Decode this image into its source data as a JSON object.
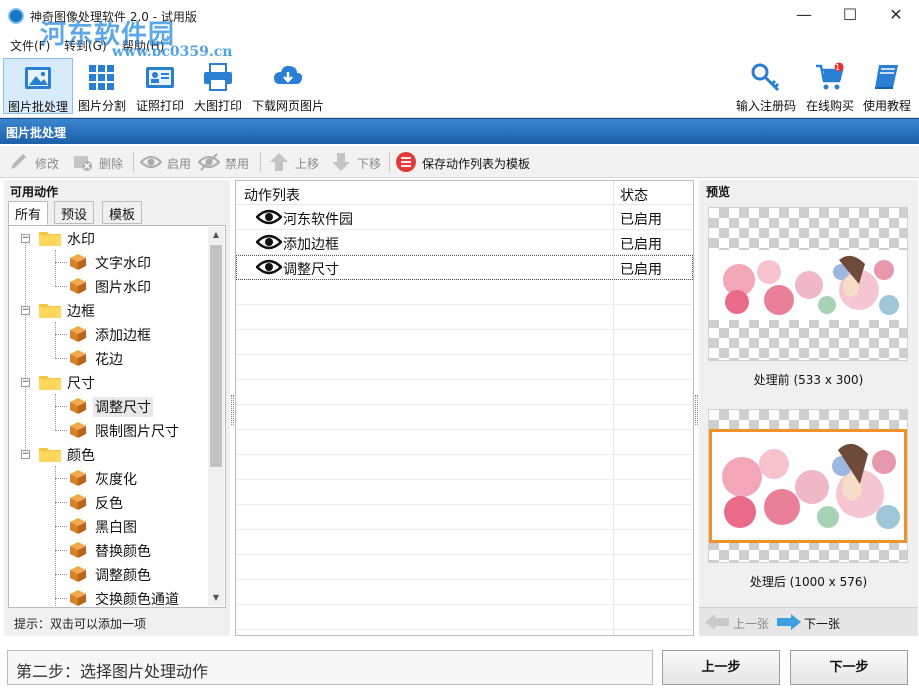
{
  "window": {
    "title": "神奇图像处理软件 2.0 - 试用版",
    "watermark_logo": "河东软件园",
    "watermark_url": "www.pc0359.cn",
    "controls": [
      "—",
      "☐",
      "✕"
    ]
  },
  "menu": [
    "文件(F)",
    "转到(G)",
    "帮助(H)"
  ],
  "toolbar": {
    "left": [
      {
        "label": "图片批处理",
        "icon": "image-icon",
        "active": true
      },
      {
        "label": "图片分割",
        "icon": "grid-icon"
      },
      {
        "label": "证照打印",
        "icon": "id-card-icon"
      },
      {
        "label": "大图打印",
        "icon": "printer-icon"
      },
      {
        "label": "下载网页图片",
        "icon": "cloud-download-icon"
      }
    ],
    "right": [
      {
        "label": "输入注册码",
        "icon": "key-icon"
      },
      {
        "label": "在线购买",
        "icon": "cart-icon",
        "badge": "1"
      },
      {
        "label": "使用教程",
        "icon": "book-icon"
      }
    ]
  },
  "section_title": "图片批处理",
  "action_toolbar": {
    "edit": "修改",
    "delete": "删除",
    "enable": "启用",
    "disable": "禁用",
    "move_up": "上移",
    "move_down": "下移",
    "save_template": "保存动作列表为模板"
  },
  "available_actions": {
    "title": "可用动作",
    "tabs": [
      "所有",
      "预设",
      "模板"
    ],
    "tree": [
      {
        "label": "水印",
        "children": [
          "文字水印",
          "图片水印"
        ]
      },
      {
        "label": "边框",
        "children": [
          "添加边框",
          "花边"
        ]
      },
      {
        "label": "尺寸",
        "children": [
          "调整尺寸",
          "限制图片尺寸"
        ]
      },
      {
        "label": "颜色",
        "children": [
          "灰度化",
          "反色",
          "黑白图",
          "替换颜色",
          "调整颜色",
          "交换颜色通道"
        ]
      }
    ],
    "hint": "提示：双击可以添加一项"
  },
  "action_list": {
    "headers": {
      "name": "动作列表",
      "status": "状态"
    },
    "rows": [
      {
        "name": "河东软件园",
        "status": "已启用"
      },
      {
        "name": "添加边框",
        "status": "已启用"
      },
      {
        "name": "调整尺寸",
        "status": "已启用"
      }
    ]
  },
  "preview": {
    "title": "预览",
    "before_label": "处理前 (533 x 300)",
    "after_label": "处理后 (1000 x 576)",
    "prev": "上一张",
    "next": "下一张",
    "border_color": "#f0922c"
  },
  "footer": {
    "step_text": "第二步：选择图片处理动作",
    "prev_button": "上一步",
    "next_button": "下一步"
  }
}
